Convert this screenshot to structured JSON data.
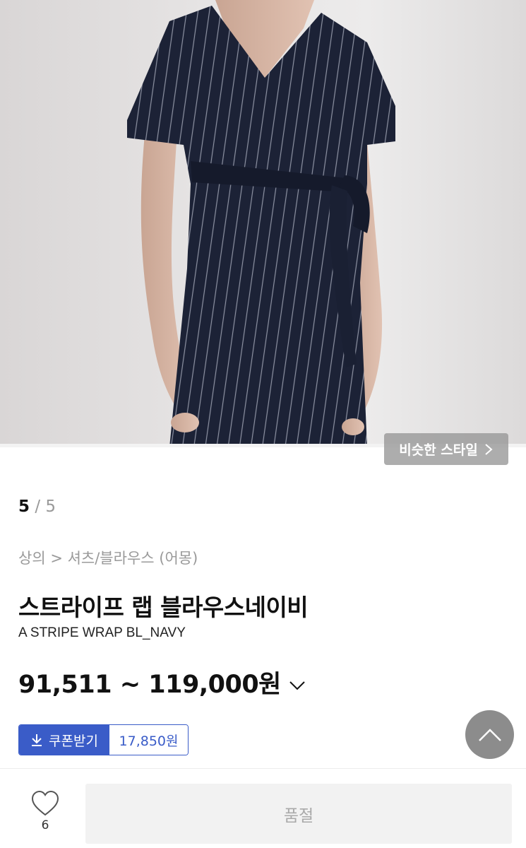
{
  "gallery": {
    "current_index": "5",
    "separator": "/",
    "total": "5",
    "similar_style_label": "비슷한 스타일"
  },
  "breadcrumb": "상의 > 셔츠/블라우스 (어몽)",
  "product": {
    "title_ko": "스트라이프 랩 블라우스네이비",
    "title_en": "A STRIPE WRAP BL_NAVY",
    "price_range": "91,511 ~ 119,000원"
  },
  "coupon": {
    "label": "쿠폰받기",
    "amount": "17,850원",
    "color": "#3a5cc8"
  },
  "bottom_bar": {
    "wish_count": "6",
    "action_label": "품절"
  },
  "icons": {
    "similar": "chevron-right-icon",
    "price": "chevron-down-icon",
    "coupon": "download-icon",
    "scroll": "arrow-up-icon",
    "wish": "heart-icon"
  }
}
